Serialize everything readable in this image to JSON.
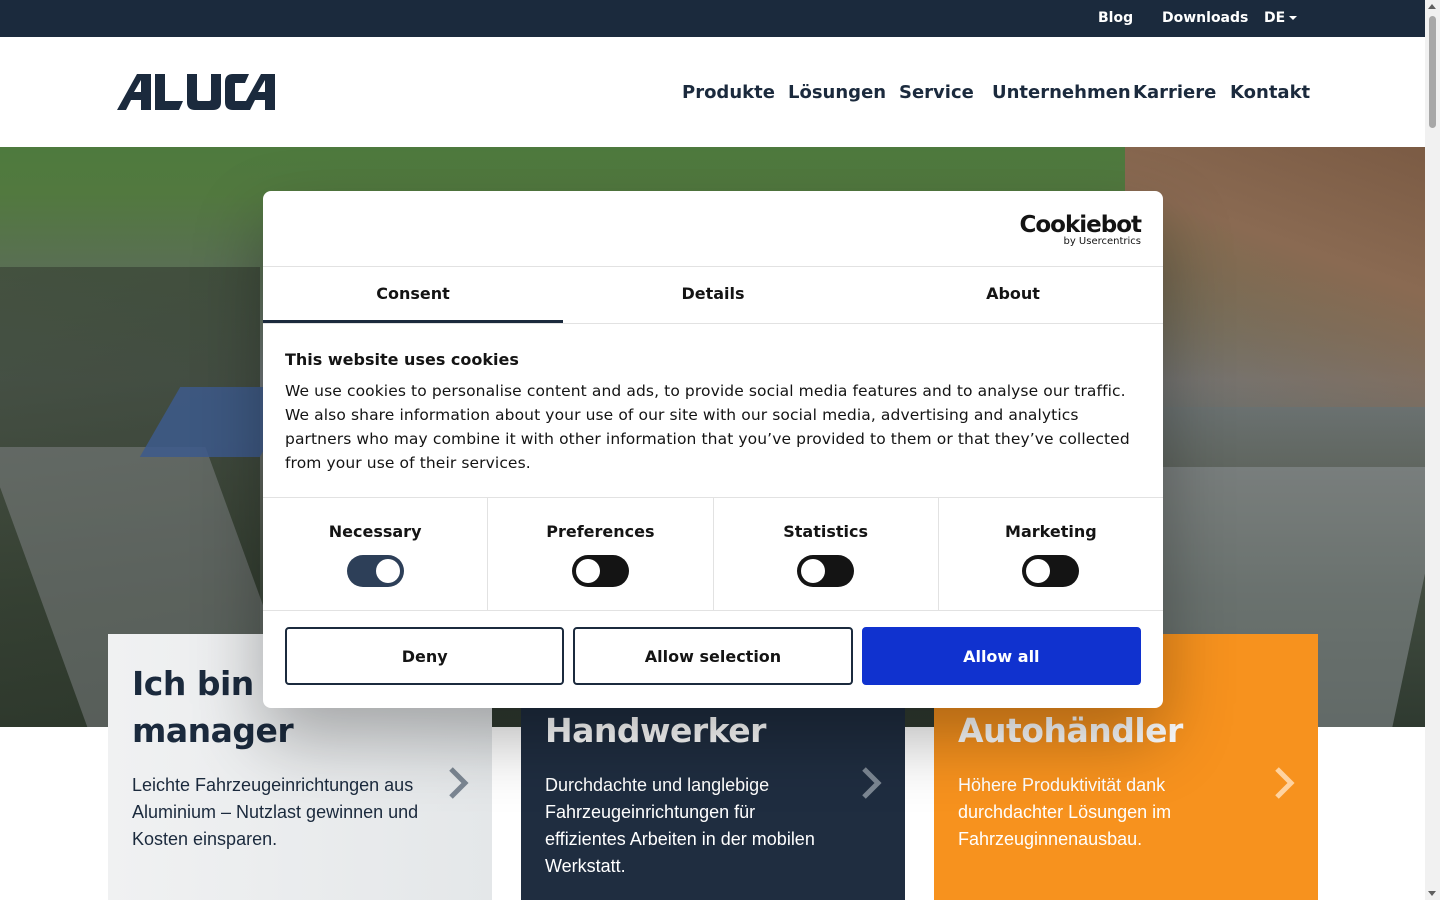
{
  "topbar": {
    "blog": "Blog",
    "downloads": "Downloads",
    "lang": "DE"
  },
  "header": {
    "logo_text": "ALUCA",
    "nav": [
      "Produkte",
      "Lösungen",
      "Service",
      "Unternehmen",
      "Karriere",
      "Kontakt"
    ]
  },
  "cards": [
    {
      "title_line1": "Ich bin F",
      "title_line2": "manager",
      "text": "Leichte Fahrzeugeinrichtungen aus Aluminium – Nutzlast gewinnen und Kosten einsparen."
    },
    {
      "title_line2": "Handwerker",
      "text": "Durchdachte und langlebige Fahrzeugeinrichtungen für effizientes Arbeiten in der mobilen Werkstatt."
    },
    {
      "title_line2": "Autohändler",
      "text": "Höhere Produktivität dank durchdachter Lösungen im Fahrzeuginnenausbau."
    }
  ],
  "cookie": {
    "brand": "Cookiebot",
    "brand_sub": "by Usercentrics",
    "tabs": [
      "Consent",
      "Details",
      "About"
    ],
    "heading": "This website uses cookies",
    "body": "We use cookies to personalise content and ads, to provide social media features and to analyse our traffic. We also share information about your use of our site with our social media, advertising and analytics partners who may combine it with other information that you’ve provided to them or that they’ve collected from your use of their services.",
    "toggles": [
      {
        "label": "Necessary",
        "state": "on"
      },
      {
        "label": "Preferences",
        "state": "off"
      },
      {
        "label": "Statistics",
        "state": "off"
      },
      {
        "label": "Marketing",
        "state": "off"
      }
    ],
    "deny": "Deny",
    "allow_selection": "Allow selection",
    "allow_all": "Allow all"
  },
  "colors": {
    "navy": "#1b2a3d",
    "orange": "#f7921e",
    "allow_all_blue": "#1032cf"
  }
}
